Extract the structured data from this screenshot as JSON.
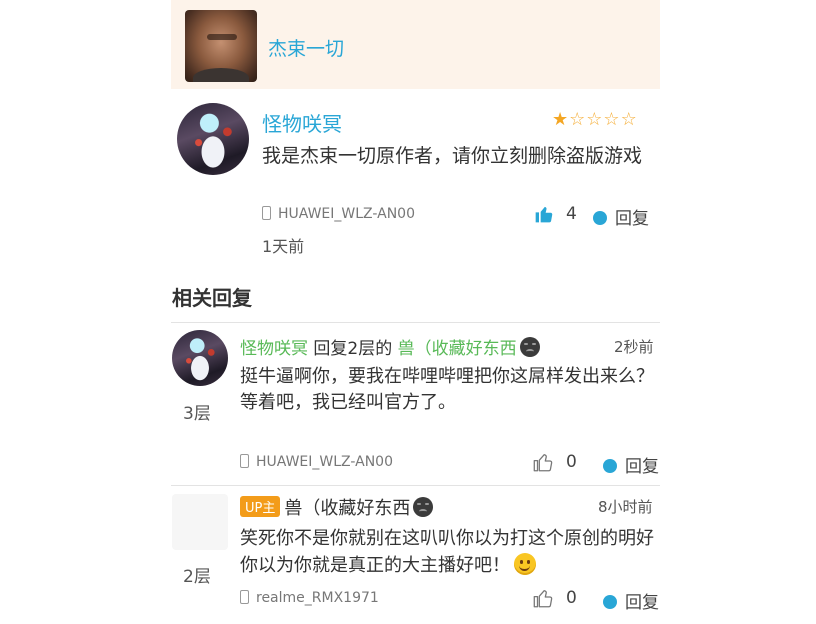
{
  "author": {
    "name": "杰束一切"
  },
  "main_comment": {
    "username": "怪物咲冥",
    "rating": 1,
    "rating_max": 5,
    "text": "我是杰束一切原作者，请你立刻删除盗版游戏",
    "device": "HUAWEI_WLZ-AN00",
    "likes": "4",
    "reply_label": "回复",
    "time": "1天前"
  },
  "section_title": "相关回复",
  "replies": [
    {
      "floor": "3层",
      "username": "怪物咲冥",
      "reply_to_prefix": "回复2层的",
      "reply_to_name": "兽（收藏好东西",
      "time": "2秒前",
      "text_line1": "挺牛逼啊你，要我在哔哩哔哩把你这屌样发出来么？",
      "text_line2": "等着吧，我已经叫官方了。",
      "device": "HUAWEI_WLZ-AN00",
      "likes": "0",
      "reply_label": "回复"
    },
    {
      "floor": "2层",
      "badge": "UP主",
      "username": "兽（收藏好东西",
      "time": "8小时前",
      "text": "笑死你不是你就别在这叭叭你以为打这个原创的明好你以为你就是真正的大主播好吧！",
      "device": "realme_RMX1971",
      "likes": "0",
      "reply_label": "回复"
    }
  ],
  "colors": {
    "name_blue": "#29a6d6",
    "reply_green": "#58b957",
    "star_orange": "#f4a623",
    "badge_orange": "#f39c1a",
    "header_bg": "#fdf3ea"
  },
  "icons": [
    "phone-icon",
    "thumbs-up-icon",
    "reply-bubble-icon",
    "star-icon",
    "mood-face-icon",
    "smile-emoji-icon"
  ]
}
